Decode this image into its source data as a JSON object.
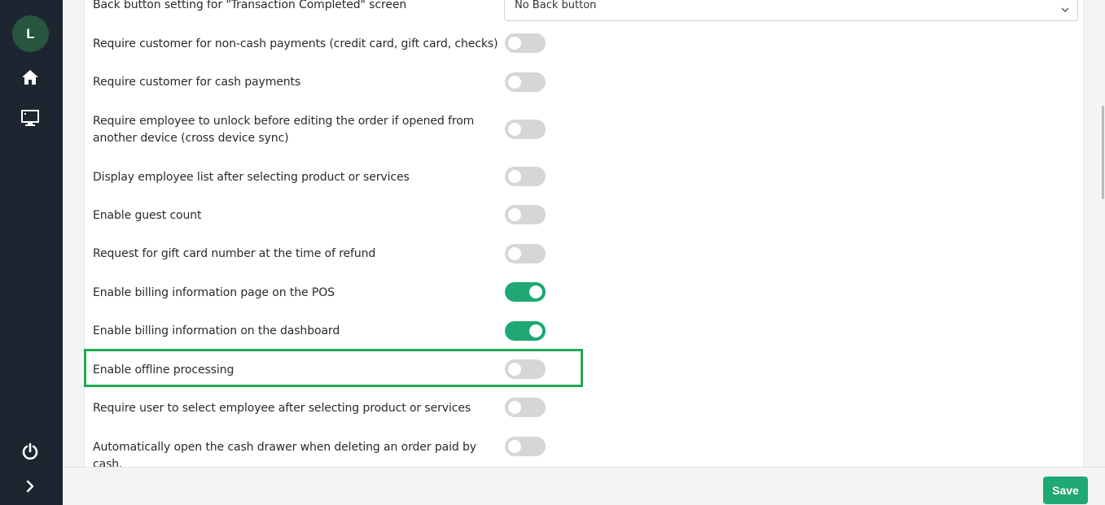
{
  "sidebar": {
    "avatar_initial": "L",
    "icons": [
      "home-icon",
      "monitor-icon",
      "power-icon",
      "chevron-right-icon"
    ]
  },
  "settings": {
    "back_button_label": "Back button setting for \"Transaction Completed\" screen",
    "back_button_value": "No Back button",
    "rows": [
      {
        "label": "Require customer for non-cash payments (credit card, gift card, checks)",
        "enabled": false
      },
      {
        "label": "Require customer for cash payments",
        "enabled": false
      },
      {
        "label": "Require employee to unlock before editing the order if opened from another device (cross device sync)",
        "enabled": false
      },
      {
        "label": "Display employee list after selecting product or services",
        "enabled": false
      },
      {
        "label": "Enable guest count",
        "enabled": false
      },
      {
        "label": "Request for gift card number at the time of refund",
        "enabled": false
      },
      {
        "label": "Enable billing information page on the POS",
        "enabled": true
      },
      {
        "label": "Enable billing information on the dashboard",
        "enabled": true
      },
      {
        "label": "Enable offline processing",
        "enabled": false
      },
      {
        "label": "Require user to select employee after selecting product or services",
        "enabled": false
      },
      {
        "label": "Automatically open the cash drawer when deleting an order paid by cash.",
        "enabled": false
      }
    ]
  },
  "footer": {
    "save_label": "Save"
  },
  "colors": {
    "accent": "#1fa774",
    "sidebar": "#1d2530",
    "highlight": "#22a951"
  }
}
